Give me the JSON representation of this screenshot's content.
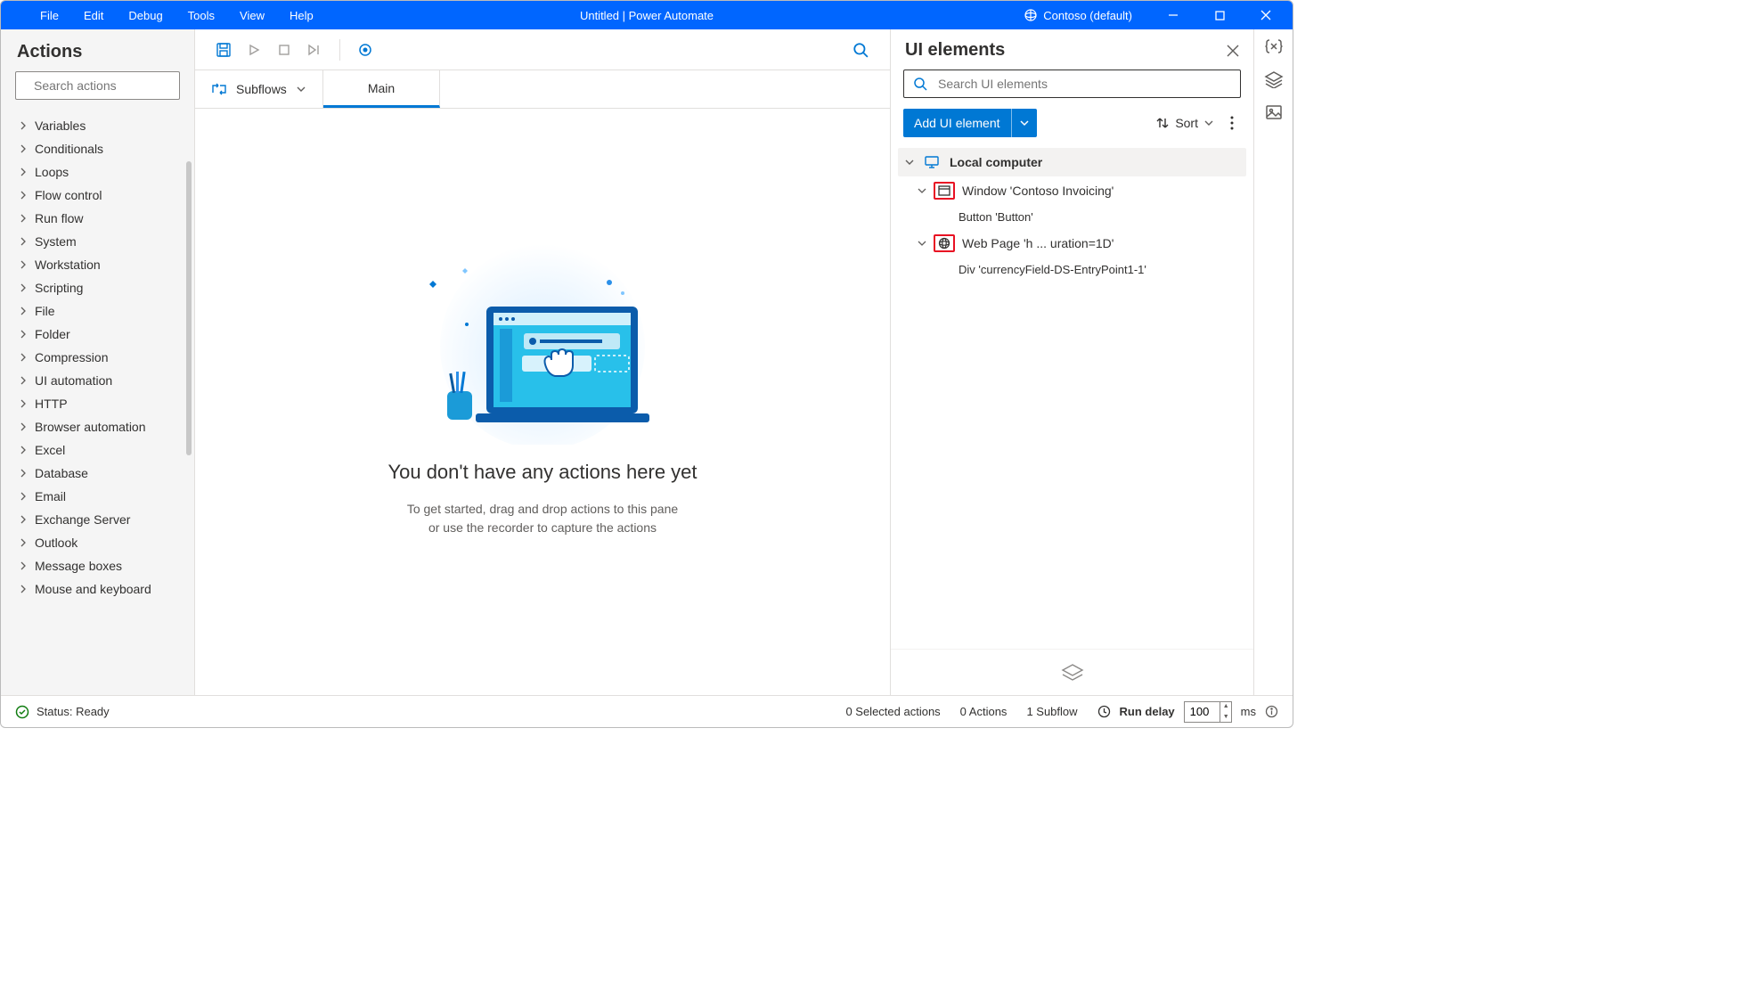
{
  "titlebar": {
    "menus": [
      "File",
      "Edit",
      "Debug",
      "Tools",
      "View",
      "Help"
    ],
    "title": "Untitled | Power Automate",
    "env": "Contoso (default)"
  },
  "sidebar": {
    "heading": "Actions",
    "search_placeholder": "Search actions",
    "items": [
      "Variables",
      "Conditionals",
      "Loops",
      "Flow control",
      "Run flow",
      "System",
      "Workstation",
      "Scripting",
      "File",
      "Folder",
      "Compression",
      "UI automation",
      "HTTP",
      "Browser automation",
      "Excel",
      "Database",
      "Email",
      "Exchange Server",
      "Outlook",
      "Message boxes",
      "Mouse and keyboard"
    ]
  },
  "tabs": {
    "subflows": "Subflows",
    "main": "Main"
  },
  "canvas": {
    "empty_title": "You don't have any actions here yet",
    "empty_line1": "To get started, drag and drop actions to this pane",
    "empty_line2": "or use the recorder to capture the actions"
  },
  "rpanel": {
    "heading": "UI elements",
    "search_placeholder": "Search UI elements",
    "add_label": "Add UI element",
    "sort_label": "Sort",
    "tree": {
      "root": "Local computer",
      "items": [
        {
          "label": "Window 'Contoso Invoicing'",
          "child": "Button 'Button'",
          "icon": "window"
        },
        {
          "label": "Web Page 'h ... uration=1D'",
          "child": "Div 'currencyField-DS-EntryPoint1-1'",
          "icon": "globe"
        }
      ]
    }
  },
  "status": {
    "ready": "Status: Ready",
    "selected": "0 Selected actions",
    "actions": "0 Actions",
    "subflow": "1 Subflow",
    "delay_label": "Run delay",
    "delay_value": "100",
    "delay_unit": "ms"
  }
}
